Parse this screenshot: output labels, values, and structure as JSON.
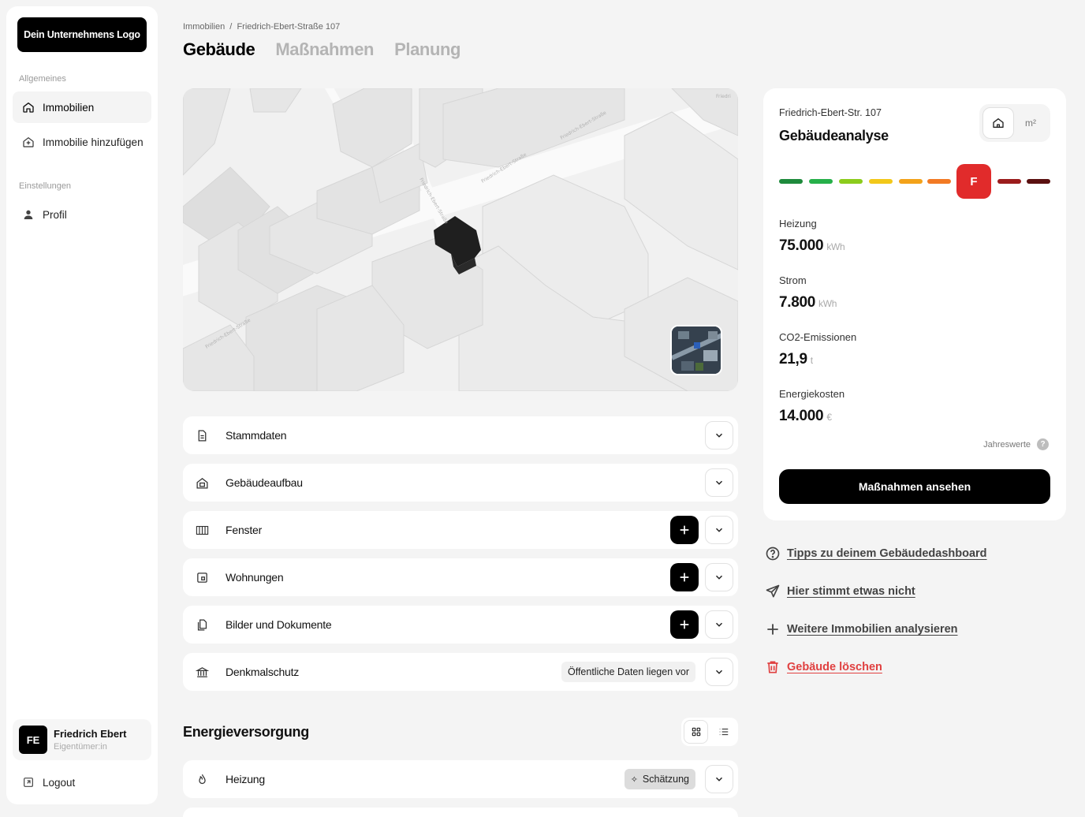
{
  "sidebar": {
    "logo": "Dein Unternehmens Logo",
    "section_general": "Allgemeines",
    "items": [
      {
        "label": "Immobilien",
        "icon": "home-icon"
      },
      {
        "label": "Immobilie hinzufügen",
        "icon": "home-plus-icon"
      }
    ],
    "section_settings": "Einstellungen",
    "settings_items": [
      {
        "label": "Profil",
        "icon": "user-icon"
      }
    ],
    "user": {
      "initials": "FE",
      "name": "Friedrich Ebert",
      "role": "Eigentümer:in"
    },
    "logout": "Logout"
  },
  "header": {
    "breadcrumb": "Immobilien  /  Friedrich-Ebert-Straße 107",
    "tabs": [
      "Gebäude",
      "Maßnahmen",
      "Planung"
    ]
  },
  "map": {
    "street_labels": [
      "Friedrich-Ebert-Straße",
      "Friedrich-Ebert-Straße",
      "Friedrich-Ebert-Straße",
      "Friedrich-Ebert-Straße"
    ],
    "corner_label": "Friedri"
  },
  "sections": [
    {
      "label": "Stammdaten",
      "icon": "document-icon",
      "add": false
    },
    {
      "label": "Gebäudeaufbau",
      "icon": "house-layers-icon",
      "add": false
    },
    {
      "label": "Fenster",
      "icon": "window-icon",
      "add": true
    },
    {
      "label": "Wohnungen",
      "icon": "apartment-icon",
      "add": true
    },
    {
      "label": "Bilder und Dokumente",
      "icon": "files-icon",
      "add": true
    },
    {
      "label": "Denkmalschutz",
      "icon": "landmark-icon",
      "add": false,
      "badge": "Öffentliche Daten liegen vor"
    }
  ],
  "energy": {
    "title": "Energieversorgung",
    "rows": [
      {
        "label": "Heizung",
        "icon": "flame-icon",
        "badge": "Schätzung"
      }
    ]
  },
  "analysis": {
    "address": "Friedrich-Ebert-Str. 107",
    "title": "Gebäudeanalyse",
    "unit_option": "m²",
    "grade": "F",
    "scale_colors": [
      "#1e8a3c",
      "#26b04a",
      "#8ccc1c",
      "#f2c81a",
      "#f3a21a",
      "#f27a24",
      "#e12b2b",
      "#9b1c1c",
      "#5a1010"
    ],
    "metrics": [
      {
        "label": "Heizung",
        "value": "75.000",
        "unit": "kWh"
      },
      {
        "label": "Strom",
        "value": "7.800",
        "unit": "kWh"
      },
      {
        "label": "CO2-Emissionen",
        "value": "21,9",
        "unit": "t"
      },
      {
        "label": "Energiekosten",
        "value": "14.000",
        "unit": "€"
      }
    ],
    "footnote": "Jahreswerte",
    "help": "?",
    "cta": "Maßnahmen ansehen"
  },
  "links": [
    {
      "label": "Tipps zu deinem Gebäudedashboard",
      "icon": "help-circle-icon"
    },
    {
      "label": "Hier stimmt etwas nicht",
      "icon": "send-icon"
    },
    {
      "label": "Weitere Immobilien analysieren",
      "icon": "plus-icon"
    },
    {
      "label": "Gebäude löschen",
      "icon": "trash-icon"
    }
  ]
}
